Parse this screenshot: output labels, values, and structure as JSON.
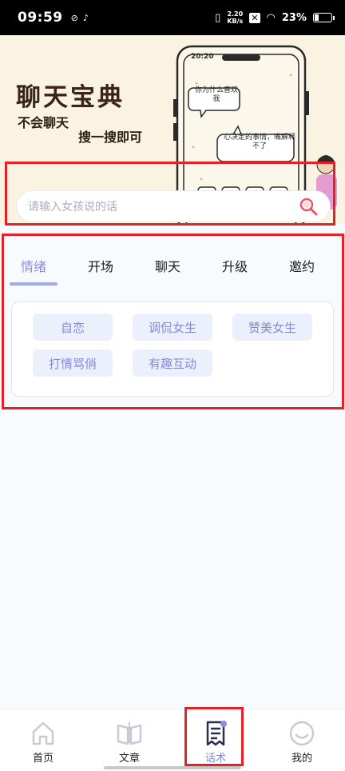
{
  "status_bar": {
    "time": "09:59",
    "net_speed_value": "2.20",
    "net_speed_unit": "KB/s",
    "battery": "23%"
  },
  "banner": {
    "title": "聊天宝典",
    "subtitle_1": "不会聊天",
    "subtitle_2": "搜一搜即可",
    "phone_time": "20:20",
    "bubble_1": "你为什么喜欢我",
    "bubble_2": "心决定的事情，嘴解释不了"
  },
  "search": {
    "placeholder": "请输入女孩说的话"
  },
  "tabs": [
    {
      "label": "情绪",
      "active": true
    },
    {
      "label": "开场",
      "active": false
    },
    {
      "label": "聊天",
      "active": false
    },
    {
      "label": "升级",
      "active": false
    },
    {
      "label": "邀约",
      "active": false
    }
  ],
  "tags": [
    "自恋",
    "调侃女生",
    "赞美女生",
    "打情骂俏",
    "有趣互动"
  ],
  "bottom_nav": [
    {
      "label": "首页",
      "icon": "home-icon",
      "active": false
    },
    {
      "label": "文章",
      "icon": "book-icon",
      "active": false
    },
    {
      "label": "话术",
      "icon": "script-icon",
      "active": true
    },
    {
      "label": "我的",
      "icon": "smile-icon",
      "active": false
    }
  ],
  "colors": {
    "accent": "#8c8ce0",
    "highlight_frame": "#e52128",
    "tag_bg": "#eceffc",
    "banner_bg": "#faf3e1"
  }
}
